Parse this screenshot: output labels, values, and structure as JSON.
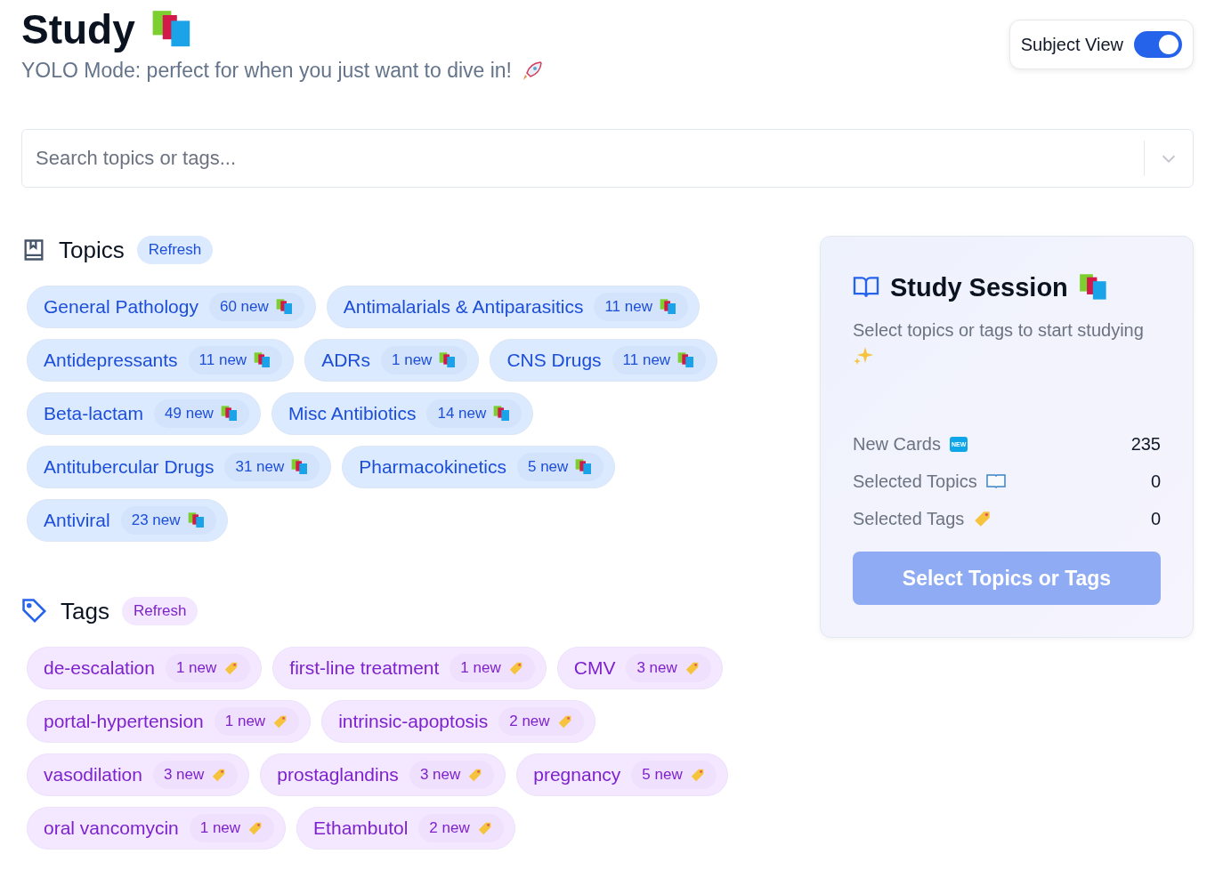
{
  "header": {
    "title": "Study",
    "subtitle": "YOLO Mode: perfect for when you just want to dive in!"
  },
  "subject_view": {
    "label": "Subject View",
    "on": true
  },
  "search": {
    "placeholder": "Search topics or tags..."
  },
  "topics": {
    "title": "Topics",
    "refresh": "Refresh",
    "items": [
      {
        "name": "General Pathology",
        "count": "60 new"
      },
      {
        "name": "Antimalarials & Antiparasitics",
        "count": "11 new"
      },
      {
        "name": "Antidepressants",
        "count": "11 new"
      },
      {
        "name": "ADRs",
        "count": "1 new"
      },
      {
        "name": "CNS Drugs",
        "count": "11 new"
      },
      {
        "name": "Beta-lactam",
        "count": "49 new"
      },
      {
        "name": "Misc Antibiotics",
        "count": "14 new"
      },
      {
        "name": "Antitubercular Drugs",
        "count": "31 new"
      },
      {
        "name": "Pharmacokinetics",
        "count": "5 new"
      },
      {
        "name": "Antiviral",
        "count": "23 new"
      }
    ]
  },
  "tags": {
    "title": "Tags",
    "refresh": "Refresh",
    "items": [
      {
        "name": "de-escalation",
        "count": "1 new"
      },
      {
        "name": "first-line treatment",
        "count": "1 new"
      },
      {
        "name": "CMV",
        "count": "3 new"
      },
      {
        "name": "portal-hypertension",
        "count": "1 new"
      },
      {
        "name": "intrinsic-apoptosis",
        "count": "2 new"
      },
      {
        "name": "vasodilation",
        "count": "3 new"
      },
      {
        "name": "prostaglandins",
        "count": "3 new"
      },
      {
        "name": "pregnancy",
        "count": "5 new"
      },
      {
        "name": "oral vancomycin",
        "count": "1 new"
      },
      {
        "name": "Ethambutol",
        "count": "2 new"
      }
    ]
  },
  "session": {
    "title": "Study Session",
    "hint": "Select topics or tags to start studying",
    "stats": [
      {
        "kind": "new",
        "label": "New Cards",
        "badge": "NEW",
        "value": "235"
      },
      {
        "kind": "book",
        "label": "Selected Topics",
        "value": "0"
      },
      {
        "kind": "tag",
        "label": "Selected Tags",
        "value": "0"
      }
    ],
    "button": {
      "label": "Select Topics or Tags",
      "disabled": true
    }
  }
}
